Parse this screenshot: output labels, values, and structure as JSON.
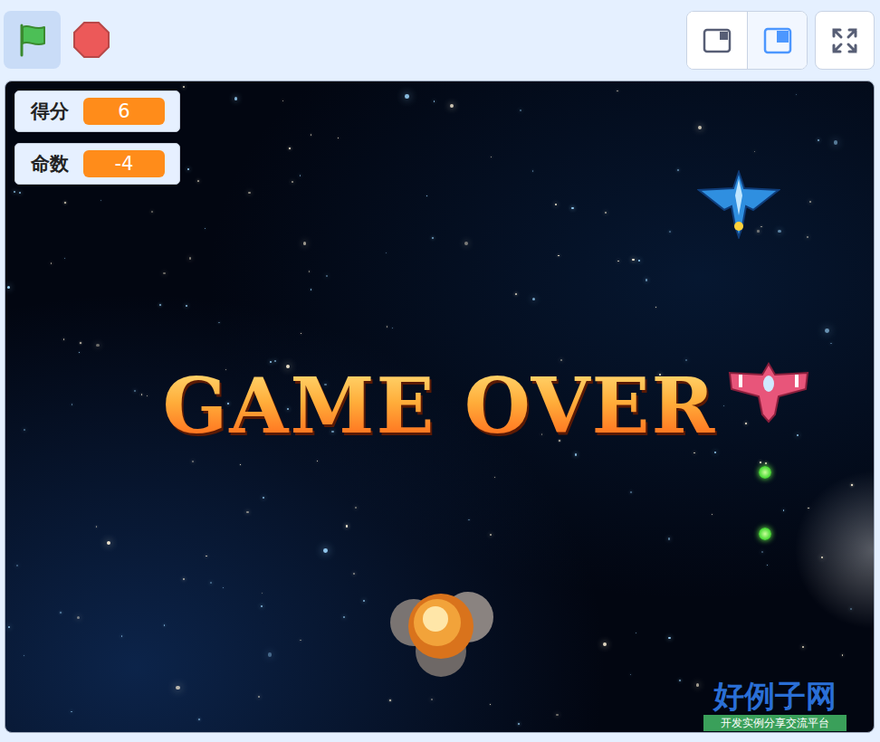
{
  "toolbar": {
    "green_flag": {
      "selected": true
    },
    "stop": {
      "selected": false
    },
    "stage_size_buttons": [
      {
        "size": "small",
        "selected": false
      },
      {
        "size": "normal",
        "selected": true
      }
    ],
    "fullscreen": {
      "selected": false
    }
  },
  "monitors": [
    {
      "label": "得分",
      "value": "6"
    },
    {
      "label": "命数",
      "value": "-4"
    }
  ],
  "overlay": {
    "text": "GAME OVER"
  },
  "watermark": {
    "title": "好例子网",
    "subtitle": "开发实例分享交流平台"
  }
}
